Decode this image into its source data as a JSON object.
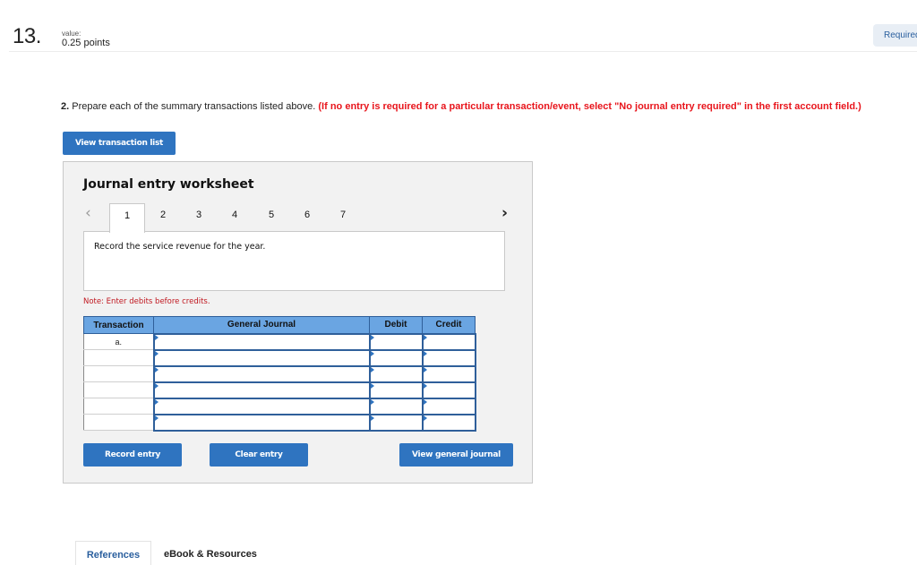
{
  "question": {
    "number": "13.",
    "value_label": "value:",
    "points": "0.25 points",
    "required_label": "Required"
  },
  "instruction": {
    "number": "2.",
    "text": " Prepare each of the summary transactions listed above. ",
    "note": "(If no entry is required for a particular transaction/event, select \"No journal entry required\" in the first account field.)"
  },
  "buttons": {
    "view_transaction_list": "View transaction list",
    "record_entry": "Record entry",
    "clear_entry": "Clear entry",
    "view_general_journal": "View general journal"
  },
  "worksheet": {
    "title": "Journal entry worksheet",
    "prev_icon": "chevron-left-icon",
    "next_icon": "chevron-right-icon",
    "tabs": [
      "1",
      "2",
      "3",
      "4",
      "5",
      "6",
      "7"
    ],
    "active_tab": "1",
    "description": "Record the service revenue for the year.",
    "note": "Note: Enter debits before credits.",
    "table": {
      "headers": [
        "Transaction",
        "General Journal",
        "Debit",
        "Credit"
      ],
      "rows": [
        {
          "transaction": "a.",
          "account": "",
          "debit": "",
          "credit": ""
        },
        {
          "transaction": "",
          "account": "",
          "debit": "",
          "credit": ""
        },
        {
          "transaction": "",
          "account": "",
          "debit": "",
          "credit": ""
        },
        {
          "transaction": "",
          "account": "",
          "debit": "",
          "credit": ""
        },
        {
          "transaction": "",
          "account": "",
          "debit": "",
          "credit": ""
        },
        {
          "transaction": "",
          "account": "",
          "debit": "",
          "credit": ""
        }
      ]
    }
  },
  "bottom_tabs": {
    "references": "References",
    "ebook": "eBook & Resources"
  }
}
